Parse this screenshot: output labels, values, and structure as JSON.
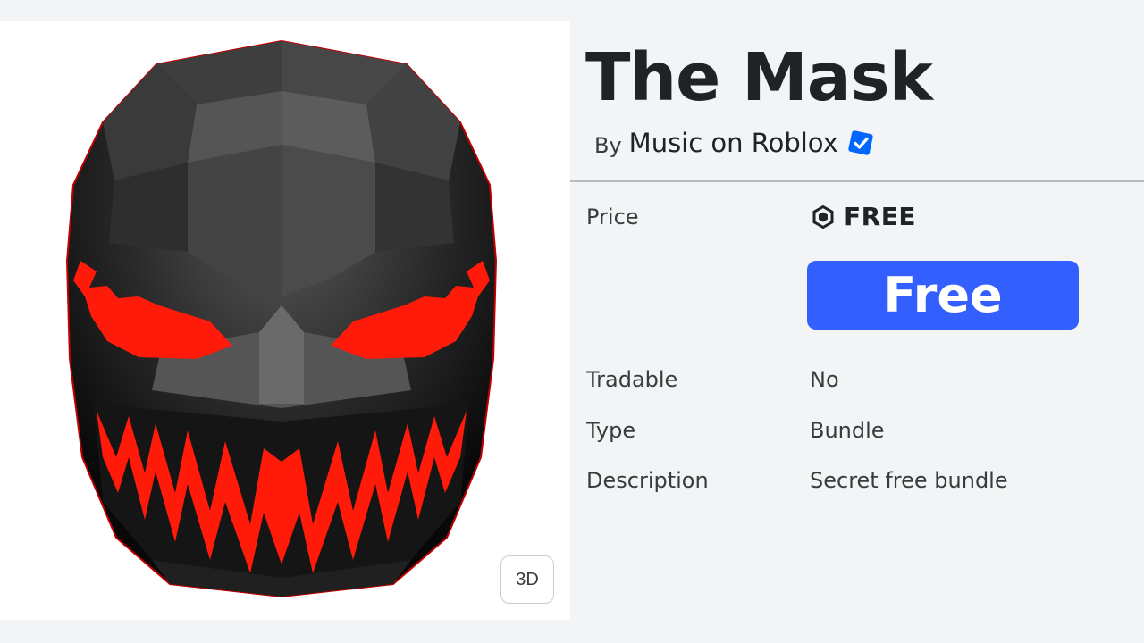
{
  "item": {
    "title": "The Mask",
    "by_prefix": "By",
    "creator": "Music on Roblox",
    "creator_verified": true
  },
  "viewer": {
    "toggle_3d_label": "3D"
  },
  "details": {
    "price_label": "Price",
    "price_value": "FREE",
    "buy_button_label": "Free",
    "tradable_label": "Tradable",
    "tradable_value": "No",
    "type_label": "Type",
    "type_value": "Bundle",
    "description_label": "Description",
    "description_value": "Secret free bundle"
  },
  "icons": {
    "robux": "robux-icon",
    "verified": "verified-badge-icon",
    "preview": "mask-thumbnail"
  },
  "colors": {
    "buy_button": "#335fff",
    "verified_badge": "#0066ff",
    "mask_accent": "#ff1a0a"
  }
}
